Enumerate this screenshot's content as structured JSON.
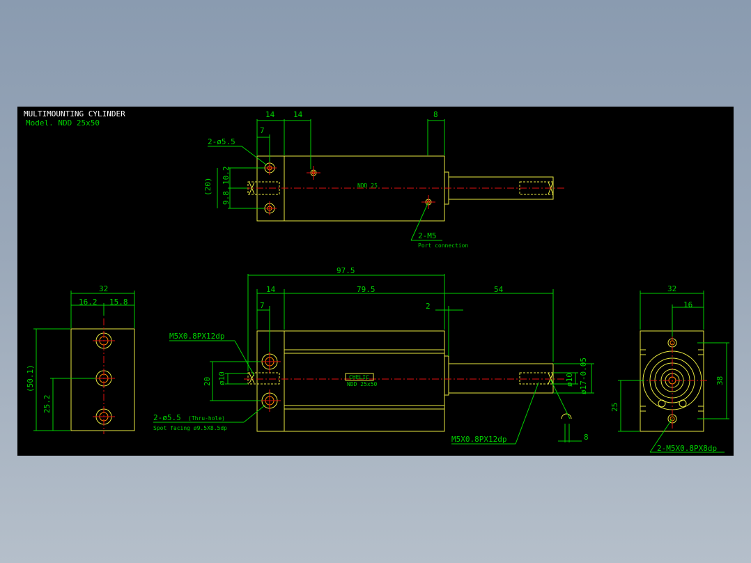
{
  "title": "MULTIMOUNTING CYLINDER",
  "model": "Model. NDD 25x50",
  "top_view": {
    "dims": [
      "14",
      "14",
      "8",
      "7",
      "10.2",
      "9.8",
      "(20)"
    ],
    "hole_label": "2-ø5.5",
    "body_text": "NDD 25",
    "port_label": "2-M5",
    "port_note": "Port connection"
  },
  "front_view": {
    "dims": [
      "97.5",
      "14",
      "79.5",
      "54",
      "7",
      "2",
      "20",
      "ø10",
      "8"
    ],
    "rod_dia": "ø10",
    "rod_end_dia": "ø17-0.05",
    "thread_left": "M5X0.8PX12dp",
    "thread_right": "M5X0.8PX12dp",
    "hole_label": "2-ø5.5",
    "hole_note": "(Thru-hole)",
    "spot_facing": "Spot facing  ø9.5X8.5dp",
    "logo": "CHELIC",
    "logo_sub": "NDD 25x50"
  },
  "side_view": {
    "dims": [
      "32",
      "16.2",
      "15.8",
      "(50.1)",
      "25.2"
    ]
  },
  "end_view": {
    "dims": [
      "32",
      "16",
      "38",
      "25"
    ],
    "thread_label": "2-M5X0.8PX8dp"
  },
  "colors": {
    "background": "#000000",
    "outline": "#e8e840",
    "dimension": "#00d000",
    "centerline": "#e01010",
    "title_text": "#ffffff"
  }
}
